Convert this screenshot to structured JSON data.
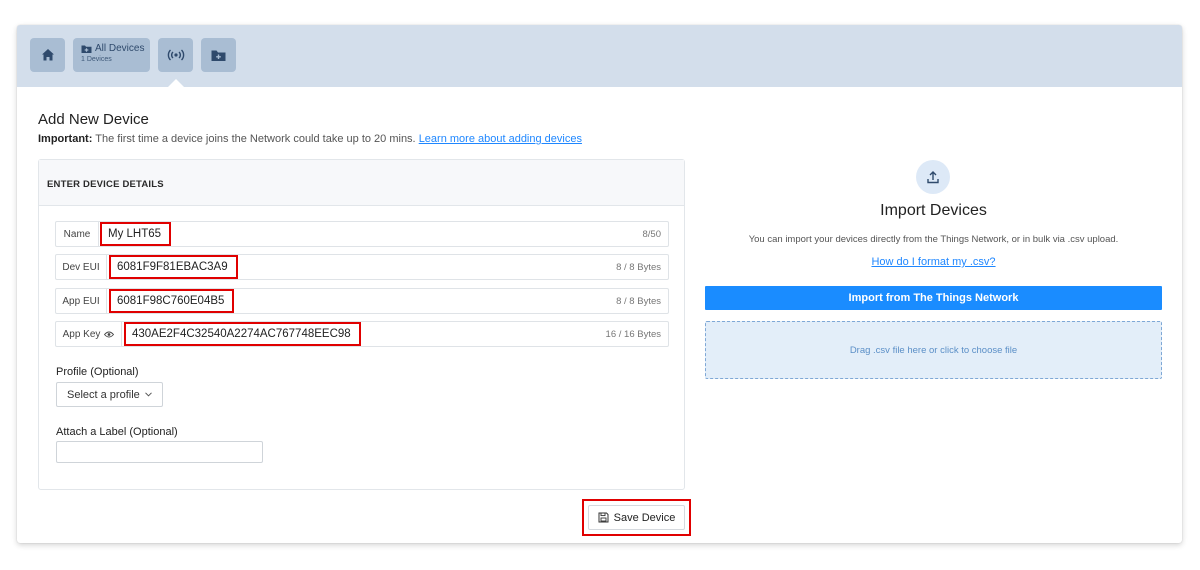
{
  "topbar": {
    "all_devices_label": "All Devices",
    "all_devices_count": "1 Devices"
  },
  "form": {
    "title": "Add New Device",
    "important_label": "Important:",
    "important_text": " The first time a device joins the Network could take up to 20 mins. ",
    "learn_more": "Learn more about adding devices",
    "panel_heading": "ENTER DEVICE DETAILS",
    "fields": [
      {
        "label": "Name",
        "value": "My LHT65",
        "count": "8/50"
      },
      {
        "label": "Dev EUI",
        "value": "6081F9F81EBAC3A9",
        "count": "8 / 8 Bytes"
      },
      {
        "label": "App EUI",
        "value": "6081F98C760E04B5",
        "count": "8 / 8 Bytes"
      },
      {
        "label": "App Key",
        "value": "430AE2F4C32540A2274AC767748EEC98",
        "count": "16 / 16 Bytes"
      }
    ],
    "profile_label": "Profile (Optional)",
    "profile_select": "Select a profile",
    "label_label": "Attach a Label (Optional)",
    "label_value": "",
    "save_button": "Save Device"
  },
  "import": {
    "title": "Import Devices",
    "description": "You can import your devices directly from the Things Network, or in bulk via .csv upload.",
    "format_link": "How do I format my .csv?",
    "ttn_button": "Import from The Things Network",
    "dropzone_text": "Drag .csv file here or click to choose file"
  },
  "colors": {
    "topbar_bg": "#d3deeb",
    "topbar_button": "#a9bdd3",
    "accent": "#1a8cff",
    "highlight_box": "#e00000"
  }
}
